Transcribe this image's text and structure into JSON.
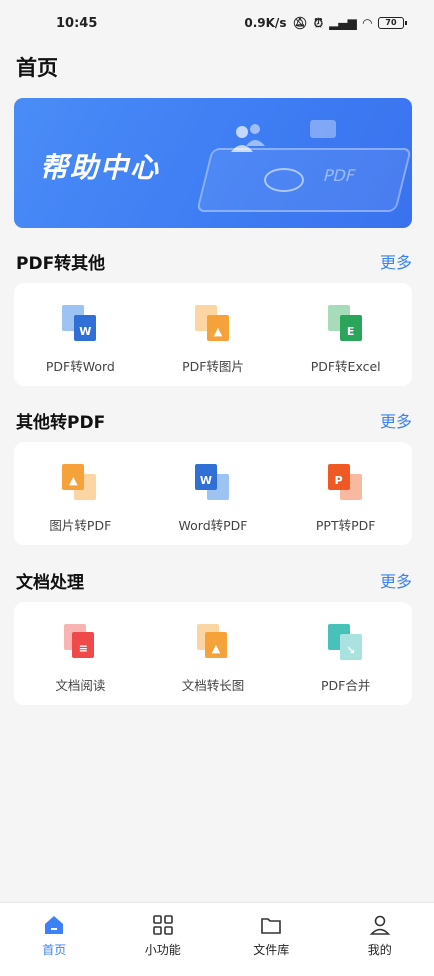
{
  "status_bar": {
    "time": "10:45",
    "speed": "0.9K/s",
    "battery": "70"
  },
  "page": {
    "title": "首页"
  },
  "banner": {
    "title": "帮助中心",
    "pdf_text": "PDF"
  },
  "sections": [
    {
      "title": "PDF转其他",
      "more": "更多",
      "tools": [
        {
          "label": "PDF转Word",
          "icon": "pdf-to-word-icon",
          "letter": "W",
          "color": "#2f6fd6",
          "back": "#9cc3f2"
        },
        {
          "label": "PDF转图片",
          "icon": "pdf-to-image-icon",
          "letter": "",
          "color": "#f6a23a",
          "back": "#fbd6a3"
        },
        {
          "label": "PDF转Excel",
          "icon": "pdf-to-excel-icon",
          "letter": "E",
          "color": "#2aa55a",
          "back": "#a6dcb9"
        }
      ]
    },
    {
      "title": "其他转PDF",
      "more": "更多",
      "tools": [
        {
          "label": "图片转PDF",
          "icon": "image-to-pdf-icon",
          "letter": "",
          "color": "#f6a23a",
          "back": "#fbd6a3"
        },
        {
          "label": "Word转PDF",
          "icon": "word-to-pdf-icon",
          "letter": "W",
          "color": "#2f6fd6",
          "back": "#9cc3f2"
        },
        {
          "label": "PPT转PDF",
          "icon": "ppt-to-pdf-icon",
          "letter": "P",
          "color": "#ef5a24",
          "back": "#f8b9a0"
        }
      ]
    },
    {
      "title": "文档处理",
      "more": "更多",
      "tools": [
        {
          "label": "文档阅读",
          "icon": "document-read-icon",
          "letter": "",
          "color": "#ef4a4a",
          "back": "#f8b3b3"
        },
        {
          "label": "文档转长图",
          "icon": "document-to-long-image-icon",
          "letter": "",
          "color": "#f6a23a",
          "back": "#fbd6a3"
        },
        {
          "label": "PDF合并",
          "icon": "pdf-merge-icon",
          "letter": "",
          "color": "#48c1b9",
          "back": "#a9e2de"
        }
      ]
    }
  ],
  "tabs": [
    {
      "label": "首页",
      "icon": "home-icon",
      "active": true
    },
    {
      "label": "小功能",
      "icon": "grid-icon",
      "active": false
    },
    {
      "label": "文件库",
      "icon": "folder-icon",
      "active": false
    },
    {
      "label": "我的",
      "icon": "user-icon",
      "active": false
    }
  ],
  "colors": {
    "accent": "#3b82f6",
    "banner": "#3e7df3",
    "background": "#f5f5f5"
  }
}
